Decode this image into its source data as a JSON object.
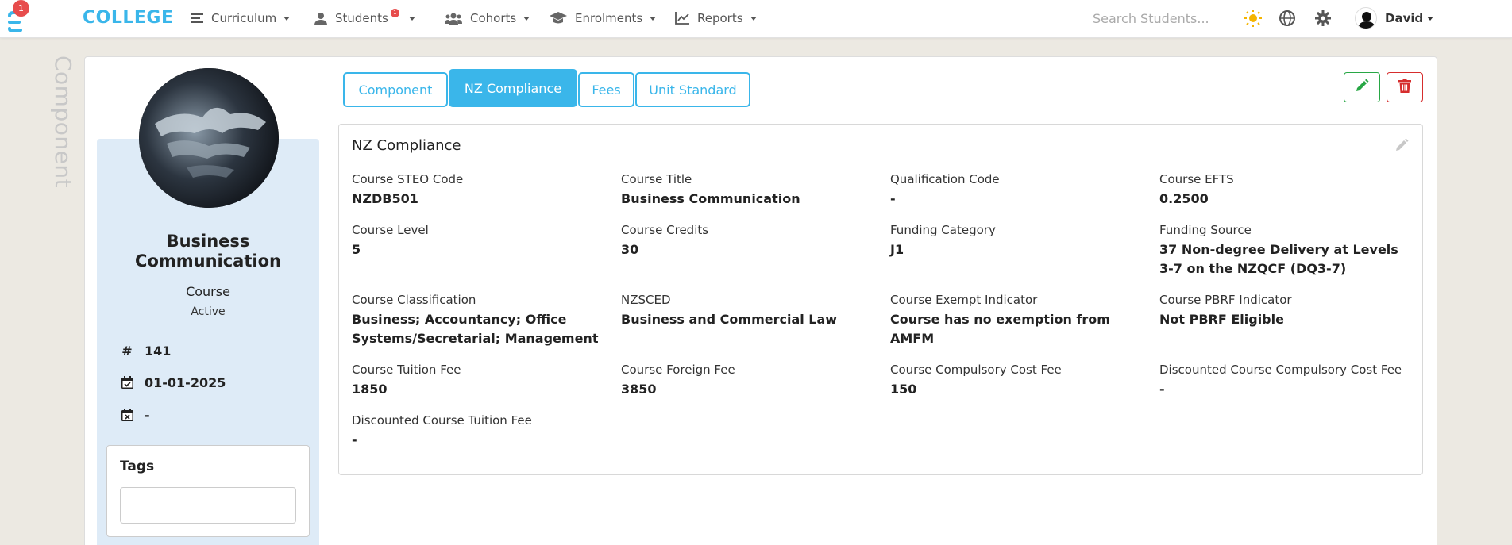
{
  "navbar": {
    "brand": "COLLEGE",
    "logo_badge": "1",
    "items": [
      {
        "label": "Curriculum"
      },
      {
        "label": "Students",
        "badge": "1"
      },
      {
        "label": "Cohorts"
      },
      {
        "label": "Enrolments"
      },
      {
        "label": "Reports"
      }
    ],
    "search_placeholder": "Search Students...",
    "user_name": "David"
  },
  "side_label": "Component",
  "profile": {
    "name": "Business Communication",
    "type": "Course",
    "status": "Active",
    "id": "141",
    "start_date": "01-01-2025",
    "end_date": "-",
    "tags_title": "Tags"
  },
  "tabs": [
    {
      "label": "Component",
      "active": false
    },
    {
      "label": "NZ Compliance",
      "active": true
    },
    {
      "label": "Fees",
      "active": false
    },
    {
      "label": "Unit Standard",
      "active": false
    }
  ],
  "panel": {
    "title": "NZ Compliance",
    "fields": [
      {
        "label": "Course STEO Code",
        "value": "NZDB501"
      },
      {
        "label": "Course Title",
        "value": "Business Communication"
      },
      {
        "label": "Qualification Code",
        "value": "-"
      },
      {
        "label": "Course EFTS",
        "value": "0.2500"
      },
      {
        "label": "Course Level",
        "value": "5"
      },
      {
        "label": "Course Credits",
        "value": "30"
      },
      {
        "label": "Funding Category",
        "value": "J1"
      },
      {
        "label": "Funding Source",
        "value": "37 Non-degree Delivery at Levels 3-7 on the NZQCF (DQ3-7)"
      },
      {
        "label": "Course Classification",
        "value": "Business; Accountancy; Office Systems/Secretarial; Management"
      },
      {
        "label": "NZSCED",
        "value": "Business and Commercial Law"
      },
      {
        "label": "Course Exempt Indicator",
        "value": "Course has no exemption from AMFM"
      },
      {
        "label": "Course PBRF Indicator",
        "value": "Not PBRF Eligible"
      },
      {
        "label": "Course Tuition Fee",
        "value": "1850"
      },
      {
        "label": "Course Foreign Fee",
        "value": "3850"
      },
      {
        "label": "Course Compulsory Cost Fee",
        "value": "150"
      },
      {
        "label": "Discounted Course Compulsory Cost Fee",
        "value": "-"
      },
      {
        "label": "Discounted Course Tuition Fee",
        "value": "-"
      }
    ]
  },
  "colors": {
    "accent": "#3ab6ea",
    "profile_bg": "#deebf7",
    "edit": "#28a745",
    "delete": "#d62d2d"
  }
}
